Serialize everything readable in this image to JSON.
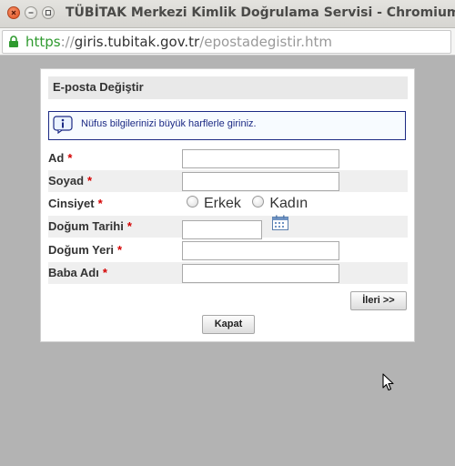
{
  "window": {
    "title": "TÜBİTAK Merkezi Kimlik Doğrulama Servisi - Chromium"
  },
  "url": {
    "scheme": "https",
    "sep": "://",
    "host": "giris.tubitak.gov.tr",
    "path": "/epostadegistir.htm"
  },
  "dialog": {
    "title": "E-posta Değiştir",
    "info": "Nüfus bilgilerinizi büyük harflerle giriniz.",
    "required_mark": "*",
    "fields": {
      "ad": {
        "label": "Ad",
        "value": ""
      },
      "soyad": {
        "label": "Soyad",
        "value": ""
      },
      "cinsiyet": {
        "label": "Cinsiyet",
        "options": [
          "Erkek",
          "Kadın"
        ]
      },
      "dogum_tarihi": {
        "label": "Doğum Tarihi",
        "value": ""
      },
      "dogum_yeri": {
        "label": "Doğum Yeri",
        "value": ""
      },
      "baba_adi": {
        "label": "Baba Adı",
        "value": ""
      }
    },
    "next_button": "İleri >>",
    "close_button": "Kapat"
  },
  "colors": {
    "required": "#d40000",
    "info_border": "#1c2a84",
    "secure_scheme": "#2f9a2f"
  }
}
